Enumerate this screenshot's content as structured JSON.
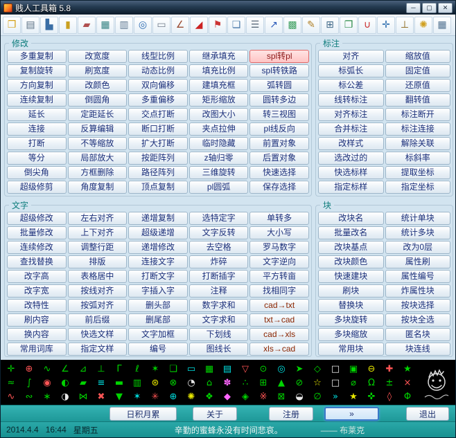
{
  "window": {
    "title": "贱人工具箱 5.8",
    "controls": [
      {
        "name": "minimize-button",
        "glyph": "─"
      },
      {
        "name": "maximize-button",
        "glyph": "▢"
      },
      {
        "name": "close-button",
        "glyph": "✕"
      }
    ]
  },
  "toolbar": {
    "icons": [
      {
        "name": "open-icon",
        "g": "❒",
        "c": "#d4a017"
      },
      {
        "name": "print-icon",
        "g": "▤",
        "c": "#5a6f82"
      },
      {
        "name": "stats-icon",
        "g": "▙",
        "c": "#3a6ea5"
      },
      {
        "name": "lock-icon",
        "g": "▮",
        "c": "#caa020"
      },
      {
        "name": "eraser-icon",
        "g": "▰",
        "c": "#b05050"
      },
      {
        "name": "table-icon",
        "g": "▦",
        "c": "#2f7f7f"
      },
      {
        "name": "form-icon",
        "g": "▥",
        "c": "#607890"
      },
      {
        "name": "search-icon",
        "g": "◎",
        "c": "#2868b0"
      },
      {
        "name": "ruler-icon",
        "g": "▭",
        "c": "#707a88"
      },
      {
        "name": "protractor-icon",
        "g": "∠",
        "c": "#9a4a30"
      },
      {
        "name": "slope-icon",
        "g": "◢",
        "c": "#cc2222"
      },
      {
        "name": "flag-icon",
        "g": "⚑",
        "c": "#cc3333"
      },
      {
        "name": "layers-icon",
        "g": "❏",
        "c": "#4878a8"
      },
      {
        "name": "document-icon",
        "g": "☰",
        "c": "#5a6a7a"
      },
      {
        "name": "export-icon",
        "g": "↗",
        "c": "#2858b8"
      },
      {
        "name": "palette-icon",
        "g": "▩",
        "c": "#3fa060"
      },
      {
        "name": "notepad-icon",
        "g": "✎",
        "c": "#b08028"
      },
      {
        "name": "calculator-icon",
        "g": "⊞",
        "c": "#3f6888"
      },
      {
        "name": "book-icon",
        "g": "❐",
        "c": "#2a8a46"
      },
      {
        "name": "magnet-icon",
        "g": "∪",
        "c": "#cc3030"
      },
      {
        "name": "node-icon",
        "g": "✛",
        "c": "#3070b0"
      },
      {
        "name": "plug-icon",
        "g": "⊥",
        "c": "#886010"
      },
      {
        "name": "wheel-icon",
        "g": "✺",
        "c": "#d0a020"
      },
      {
        "name": "grid-icon",
        "g": "▦",
        "c": "#50708f"
      }
    ]
  },
  "groups": {
    "modify": {
      "title": "修改",
      "buttons": [
        "多重复制",
        "改宽度",
        "线型比例",
        "继承填充",
        "spl转pl",
        "复制旋转",
        "刷宽度",
        "动态比例",
        "填充比例",
        "spl转铁路",
        "方向复制",
        "改颜色",
        "双向偏移",
        "建填充框",
        "弧转圆",
        "连续复制",
        "倒圆角",
        "多重偏移",
        "矩形缩放",
        "圆转多边",
        "延长",
        "定距延长",
        "交点打断",
        "改图大小",
        "转三视图",
        "连接",
        "反算编辑",
        "断口打断",
        "夹点拉伸",
        "pl线反向",
        "打断",
        "不等缩放",
        "扩大打断",
        "临时隐藏",
        "前置对象",
        "等分",
        "局部放大",
        "按距阵列",
        "z轴归零",
        "后置对象",
        "倒尖角",
        "方框删除",
        "路径阵列",
        "三维旋转",
        "快速选择",
        "超级修剪",
        "角度复制",
        "顶点复制",
        "pl圆弧",
        "保存选择"
      ]
    },
    "dimension": {
      "title": "标注",
      "buttons": [
        "对齐",
        "缩放值",
        "标弧长",
        "固定值",
        "标公差",
        "还原值",
        "线转标注",
        "翻转值",
        "对齐标注",
        "标注断开",
        "合并标注",
        "标注连接",
        "改样式",
        "解除关联",
        "选改过的",
        "标斜率",
        "快选标样",
        "提取坐标",
        "指定标样",
        "指定坐标"
      ]
    },
    "text": {
      "title": "文字",
      "buttons": [
        "超级修改",
        "左右对齐",
        "递增复制",
        "选特定字",
        "单转多",
        "批量修改",
        "上下对齐",
        "超级递增",
        "文字反转",
        "大小写",
        "连续修改",
        "调整行距",
        "递增修改",
        "去空格",
        "罗马数字",
        "查找替换",
        "排版",
        "连接文字",
        "炸碎",
        "文字逆向",
        "改字高",
        "表格居中",
        "打断文字",
        "打断插字",
        "平方转亩",
        "改字宽",
        "按线对齐",
        "字插入字",
        "注释",
        "找相同字",
        "改特性",
        "按弧对齐",
        "删头部",
        "数字求和",
        "cad→txt",
        "刷内容",
        "前后缀",
        "删尾部",
        "文字求和",
        "txt→cad",
        "换内容",
        "快选文样",
        "文字加框",
        "下划线",
        "cad→xls",
        "常用词库",
        "指定文样",
        "编号",
        "图线长",
        "xls→cad"
      ]
    },
    "block": {
      "title": "块",
      "buttons": [
        "改块名",
        "统计单块",
        "批量改名",
        "统计多块",
        "改块基点",
        "改为0层",
        "改块颜色",
        "属性刷",
        "快速建块",
        "属性编号",
        "刷块",
        "炸属性块",
        "替换块",
        "按块选择",
        "多块旋转",
        "按块全选",
        "多块缩放",
        "匿名块",
        "常用块",
        "块连线"
      ]
    }
  },
  "palette": {
    "icons": [
      {
        "g": "✛",
        "c": "#00d400"
      },
      {
        "g": "⊕",
        "c": "#ff5555"
      },
      {
        "g": "∿",
        "c": "#00d400"
      },
      {
        "g": "∠",
        "c": "#00d400"
      },
      {
        "g": "⊿",
        "c": "#00d400"
      },
      {
        "g": "⊥",
        "c": "#00d400"
      },
      {
        "g": "Γ",
        "c": "#00d400"
      },
      {
        "g": "ℓ",
        "c": "#00d400"
      },
      {
        "g": "✶",
        "c": "#00d400"
      },
      {
        "g": "❏",
        "c": "#00d400"
      },
      {
        "g": "▭",
        "c": "#00e0e0"
      },
      {
        "g": "▦",
        "c": "#00d400"
      },
      {
        "g": "▤",
        "c": "#00e0e0"
      },
      {
        "g": "▽",
        "c": "#ff5555"
      },
      {
        "g": "⊙",
        "c": "#00d400"
      },
      {
        "g": "◎",
        "c": "#00e0e0"
      },
      {
        "g": "➤",
        "c": "#00d400"
      },
      {
        "g": "◇",
        "c": "#00d400"
      },
      {
        "g": "□",
        "c": "#e8e8e8"
      },
      {
        "g": "▣",
        "c": "#00d400"
      },
      {
        "g": "⊖",
        "c": "#e8e800"
      },
      {
        "g": "✚",
        "c": "#ff5555"
      },
      {
        "g": "★",
        "c": "#00d400"
      },
      {
        "g": "≈",
        "c": "#00d400"
      },
      {
        "g": "∫",
        "c": "#00d400"
      },
      {
        "g": "◉",
        "c": "#ff5555"
      },
      {
        "g": "◐",
        "c": "#00d400"
      },
      {
        "g": "▰",
        "c": "#00d400"
      },
      {
        "g": "≡",
        "c": "#00e0e0"
      },
      {
        "g": "▬",
        "c": "#00d400"
      },
      {
        "g": "▥",
        "c": "#00d400"
      },
      {
        "g": "⊛",
        "c": "#e8e800"
      },
      {
        "g": "⊗",
        "c": "#00d400"
      },
      {
        "g": "◔",
        "c": "#e8e8e8"
      },
      {
        "g": "⌂",
        "c": "#00d400"
      },
      {
        "g": "✽",
        "c": "#ff66ff"
      },
      {
        "g": "∴",
        "c": "#00d400"
      },
      {
        "g": "⊞",
        "c": "#00d400"
      },
      {
        "g": "▲",
        "c": "#00d400"
      },
      {
        "g": "⊘",
        "c": "#00d400"
      },
      {
        "g": "☆",
        "c": "#e8e800"
      },
      {
        "g": "□",
        "c": "#e8e8e8"
      },
      {
        "g": "⌀",
        "c": "#00d400"
      },
      {
        "g": "Ω",
        "c": "#00d400"
      },
      {
        "g": "±",
        "c": "#00d400"
      },
      {
        "g": "×",
        "c": "#ff5555"
      },
      {
        "g": "∿",
        "c": "#ff5555"
      },
      {
        "g": "∾",
        "c": "#00d400"
      },
      {
        "g": "∗",
        "c": "#00d400"
      },
      {
        "g": "◑",
        "c": "#e8e8e8"
      },
      {
        "g": "⋈",
        "c": "#00d400"
      },
      {
        "g": "✖",
        "c": "#ff5555"
      },
      {
        "g": "▼",
        "c": "#00d400"
      },
      {
        "g": "✶",
        "c": "#00e0e0"
      },
      {
        "g": "✳",
        "c": "#ff5555"
      },
      {
        "g": "⊕",
        "c": "#00e0e0"
      },
      {
        "g": "✺",
        "c": "#e8e800"
      },
      {
        "g": "❖",
        "c": "#00d400"
      },
      {
        "g": "◆",
        "c": "#ff66ff"
      },
      {
        "g": "◈",
        "c": "#00d400"
      },
      {
        "g": "※",
        "c": "#ff5555"
      },
      {
        "g": "⊠",
        "c": "#00d400"
      },
      {
        "g": "◒",
        "c": "#e8e8e8"
      },
      {
        "g": "∅",
        "c": "#00d400"
      },
      {
        "g": "»",
        "c": "#00e0e0"
      },
      {
        "g": "★",
        "c": "#e8e800"
      },
      {
        "g": "✜",
        "c": "#00d400"
      },
      {
        "g": "◊",
        "c": "#ff5555"
      },
      {
        "g": "Φ",
        "c": "#00d400"
      }
    ]
  },
  "footer": {
    "buttons": [
      {
        "name": "tips-button",
        "label": "日积月累"
      },
      {
        "name": "about-button",
        "label": "关于"
      },
      {
        "name": "register-button",
        "label": "注册"
      },
      {
        "name": "expand-button",
        "label": "»"
      },
      {
        "name": "exit-button",
        "label": "退出"
      }
    ]
  },
  "statusbar": {
    "date": "2014.4.4",
    "time": "16:44",
    "weekday": "星期五",
    "quote": "辛勤的蜜蜂永没有时间悲哀。",
    "author": "—— 布莱克"
  },
  "special": {
    "hot_label": "spl转pl",
    "maroon_labels": [
      "cad→txt",
      "txt→cad",
      "cad→xls",
      "xls→cad"
    ],
    "focus_label": "»"
  },
  "colors": {
    "teal_accent": "#1e9898",
    "group_title": "#0c7b7b",
    "button_text": "#1b2f7a",
    "hot_button_bg": "#ffc4c4",
    "palette_green": "#00d400"
  }
}
